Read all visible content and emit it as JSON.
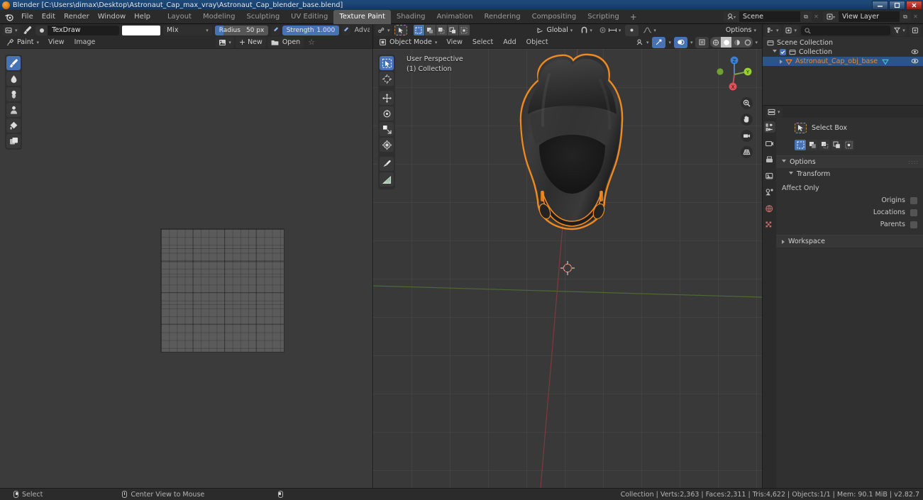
{
  "window": {
    "title": "Blender [C:\\Users\\dimax\\Desktop\\Astronaut_Cap_max_vray\\Astronaut_Cap_blender_base.blend]",
    "minimize": "–",
    "restore": "❐",
    "close": "✕"
  },
  "menu": {
    "items": [
      "File",
      "Edit",
      "Render",
      "Window",
      "Help"
    ]
  },
  "workspace_tabs": {
    "items": [
      "Layout",
      "Modeling",
      "Sculpting",
      "UV Editing",
      "Texture Paint",
      "Shading",
      "Animation",
      "Rendering",
      "Compositing",
      "Scripting"
    ],
    "active": "Texture Paint",
    "add_label": "+"
  },
  "topbar_right": {
    "scene_name": "Scene",
    "view_layer_name": "View Layer",
    "copy_icon": "⧉",
    "x_icon": "✕",
    "chevron": "▾"
  },
  "image_editor": {
    "brush_name": "TexDraw",
    "blend_mode": "Mix",
    "radius_label": "Radius",
    "radius_value": "50 px",
    "strength_label": "Strength",
    "strength_value": "1.000",
    "advanced_label": "Adva",
    "mode": "Paint",
    "menus": [
      "View",
      "Image"
    ],
    "new_button": "New",
    "open_button": "Open",
    "pin_icon": "☆",
    "tools": [
      {
        "name": "draw-tool",
        "label": "Draw",
        "active": true
      },
      {
        "name": "soften-tool",
        "label": "Soften",
        "active": false
      },
      {
        "name": "smear-tool",
        "label": "Smear",
        "active": false
      },
      {
        "name": "clone-tool",
        "label": "Clone",
        "active": false
      },
      {
        "name": "fill-tool",
        "label": "Fill",
        "active": false
      },
      {
        "name": "mask-tool",
        "label": "Mask",
        "active": false
      }
    ]
  },
  "viewport": {
    "mode": "Object Mode",
    "menus": [
      "View",
      "Select",
      "Add",
      "Object"
    ],
    "transform_orientation": "Global",
    "options_label": "Options",
    "overlay_line1": "User Perspective",
    "overlay_line2": "(1) Collection",
    "axis_x": "X",
    "axis_y": "Y",
    "axis_z": "Z",
    "tools": [
      {
        "name": "select-box-tool",
        "label": "Select Box",
        "active": true
      },
      {
        "name": "cursor-tool",
        "label": "Cursor",
        "active": false
      },
      {
        "name": "move-tool",
        "label": "Move",
        "active": false
      },
      {
        "name": "rotate-tool",
        "label": "Rotate",
        "active": false
      },
      {
        "name": "scale-tool",
        "label": "Scale",
        "active": false
      },
      {
        "name": "transform-tool",
        "label": "Transform",
        "active": false
      },
      {
        "name": "annotate-tool",
        "label": "Annotate",
        "active": false
      },
      {
        "name": "measure-tool",
        "label": "Measure",
        "active": false
      }
    ]
  },
  "outliner": {
    "search_placeholder": "",
    "rows": [
      {
        "label": "Scene Collection",
        "indent": 0,
        "selected": false,
        "has_eye": false
      },
      {
        "label": "Collection",
        "indent": 1,
        "selected": false,
        "has_eye": true
      },
      {
        "label": "Astronaut_Cap_obj_base",
        "indent": 2,
        "selected": true,
        "has_eye": true
      }
    ]
  },
  "properties": {
    "active_tool_title": "Select Box",
    "panels": {
      "options": "Options",
      "transform": "Transform",
      "affect_only": "Affect Only",
      "workspace": "Workspace"
    },
    "affect_only_items": [
      "Origins",
      "Locations",
      "Parents"
    ],
    "tabs": [
      {
        "name": "tool-tab",
        "active": true
      },
      {
        "name": "render-tab",
        "active": false
      },
      {
        "name": "output-tab",
        "active": false
      },
      {
        "name": "view-layer-tab",
        "active": false
      },
      {
        "name": "scene-tab",
        "active": false
      },
      {
        "name": "world-tab",
        "active": false
      },
      {
        "name": "object-tab",
        "active": false
      },
      {
        "name": "texture-tab",
        "active": false
      }
    ]
  },
  "statusbar": {
    "hint_select": "Select",
    "hint_center_view": "Center View to Mouse",
    "stats": "Collection | Verts:2,363 | Faces:2,311 | Tris:4,622 | Objects:1/1 | Mem: 90.1 MiB | v2.82.7"
  },
  "colors": {
    "accent_blue": "#4772b3",
    "selection_orange": "#e08b41",
    "axis_x": "#e05a5a",
    "axis_y": "#8ccf3c",
    "axis_z": "#3b82d6"
  }
}
